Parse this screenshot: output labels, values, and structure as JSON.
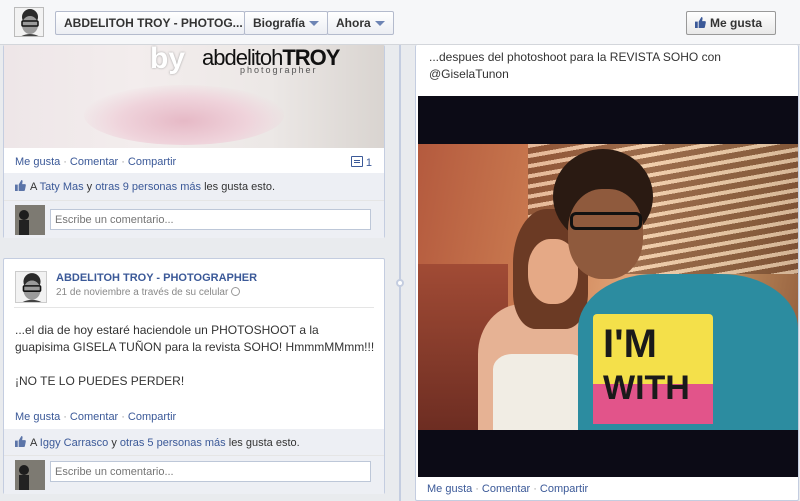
{
  "header": {
    "page_title": "ABDELITOH TROY - PHOTOG...",
    "bio_label": "Biografía",
    "now_label": "Ahora",
    "like_label": "Me gusta"
  },
  "left_top_post": {
    "watermark_by": "by",
    "watermark_name_light": "abdelitoh",
    "watermark_name_bold": "TROY",
    "watermark_sub": "photographer",
    "actions": {
      "like": "Me gusta",
      "comment": "Comentar",
      "share": "Compartir"
    },
    "comment_count": "1",
    "likes_prefix": "A",
    "likes_person": "Taty Mas",
    "likes_middle": "y",
    "likes_others": "otras 9 personas más",
    "likes_suffix": "les gusta esto.",
    "comment_placeholder": "Escribe un comentario..."
  },
  "left_bottom_post": {
    "author": "ABDELITOH TROY - PHOTOGRAPHER",
    "meta": "21 de noviembre a través de su celular",
    "text_line1": "...el dia de hoy estaré haciendole un PHOTOSHOOT a la",
    "text_line2": "guapisima GISELA TUÑON para la revista SOHO! HmmmMMmm!!!",
    "text_line3": "¡NO TE LO PUEDES PERDER!",
    "actions": {
      "like": "Me gusta",
      "comment": "Comentar",
      "share": "Compartir"
    },
    "likes_prefix": "A",
    "likes_person": "Iggy Carrasco",
    "likes_middle": "y",
    "likes_others": "otras 5 personas más",
    "likes_suffix": "les gusta esto.",
    "comment_placeholder": "Escribe un comentario..."
  },
  "right_post": {
    "text_line1": "...despues del photoshoot para la REVISTA SOHO con",
    "text_line2": "@GiselaTunon",
    "shirt_text_1": "I'M",
    "shirt_text_2": "WITH",
    "actions": {
      "like": "Me gusta",
      "comment": "Comentar",
      "share": "Compartir"
    }
  },
  "colors": {
    "link": "#3b5998",
    "ufi_bg": "#edeff4",
    "timeline": "#c4cde0"
  }
}
